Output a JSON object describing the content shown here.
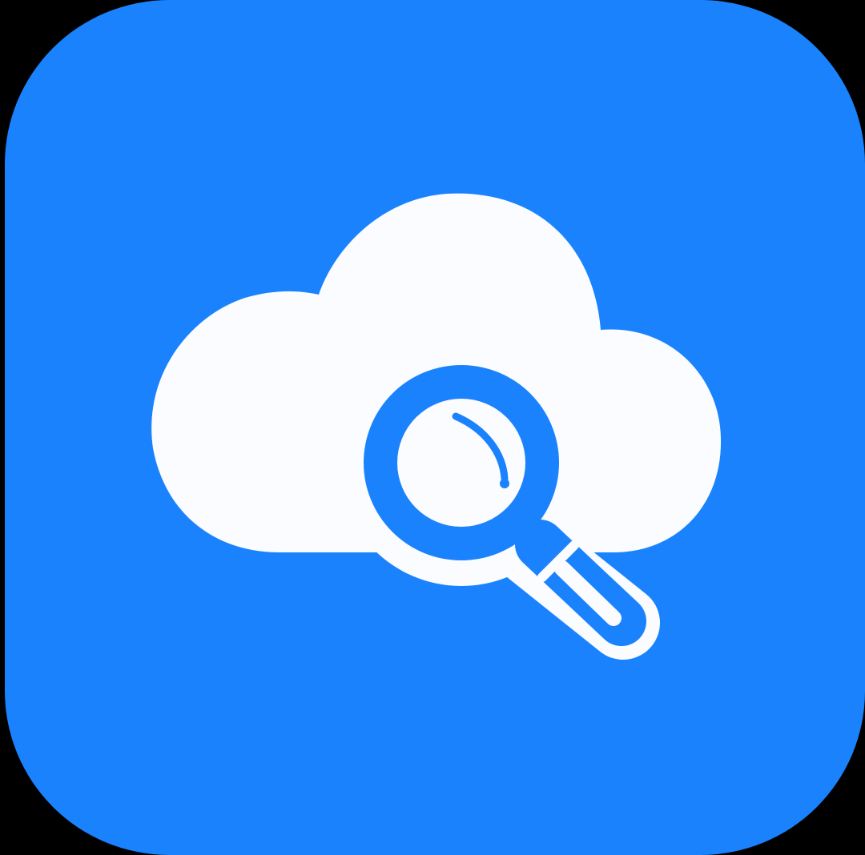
{
  "icon": {
    "name": "cloud-search-app-icon",
    "background_color": "#1A82FD",
    "glyph_color": "#FAFCFF",
    "outer_background_color": "#000000",
    "glyphs": [
      "cloud-icon",
      "magnifying-glass-icon"
    ]
  }
}
